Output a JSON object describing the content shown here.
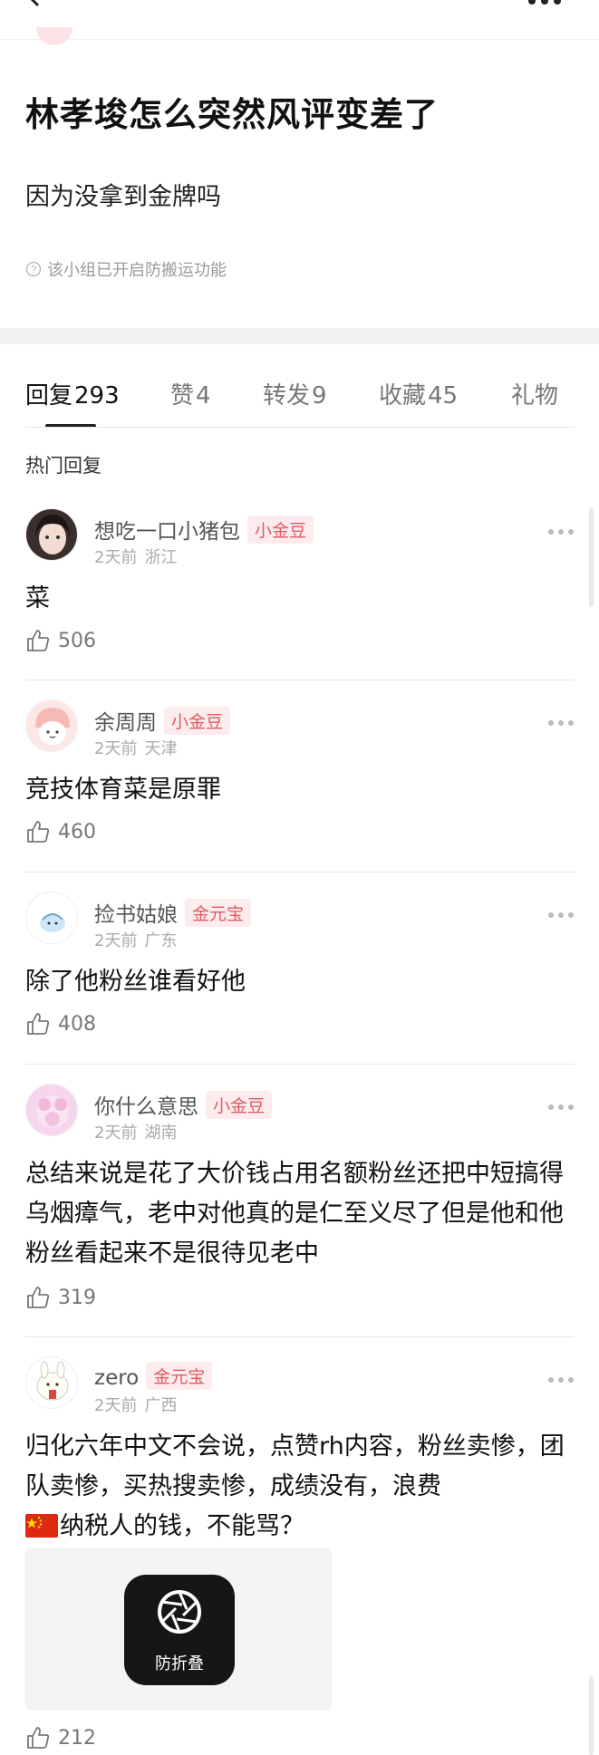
{
  "post": {
    "title": "林孝埈怎么突然风评变差了",
    "body": "因为没拿到金牌吗",
    "notice": "该小组已开启防搬运功能"
  },
  "tabs": [
    {
      "label": "回复",
      "count": "293"
    },
    {
      "label": "赞",
      "count": "4"
    },
    {
      "label": "转发",
      "count": "9"
    },
    {
      "label": "收藏",
      "count": "45"
    },
    {
      "label": "礼物",
      "count": ""
    }
  ],
  "section_label": "热门回复",
  "comments": [
    {
      "username": "想吃一口小猪包",
      "badge": "小金豆",
      "time": "2天前",
      "location": "浙江",
      "text": "菜",
      "likes": "506"
    },
    {
      "username": "余周周",
      "badge": "小金豆",
      "time": "2天前",
      "location": "天津",
      "text": "竞技体育菜是原罪",
      "likes": "460"
    },
    {
      "username": "捡书姑娘",
      "badge": "金元宝",
      "time": "2天前",
      "location": "广东",
      "text": "除了他粉丝谁看好他",
      "likes": "408"
    },
    {
      "username": "你什么意思",
      "badge": "小金豆",
      "time": "2天前",
      "location": "湖南",
      "text": "总结来说是花了大价钱占用名额粉丝还把中短搞得乌烟瘴气，老中对他真的是仁至义尽了但是他和他粉丝看起来不是很待见老中",
      "likes": "319"
    },
    {
      "username": "zero",
      "badge": "金元宝",
      "time": "2天前",
      "location": "广西",
      "text_line1": "归化六年中文不会说，点赞rh内容，粉丝卖惨，团队卖惨，买热搜卖惨，成绩没有，浪费",
      "text_line2": "纳税人的钱，不能骂？",
      "image_label": "防折叠",
      "likes": "212"
    }
  ],
  "icons": {
    "back": "chevron-left-icon",
    "more": "more-dots-icon",
    "like": "thumbs-up-icon",
    "notice": "question-circle-icon",
    "flag": "china-flag-icon",
    "app": "camera-aperture-icon"
  },
  "colors": {
    "badge_text": "#e05a63",
    "badge_bg": "#fdecee",
    "band": "#f1f1f1"
  }
}
